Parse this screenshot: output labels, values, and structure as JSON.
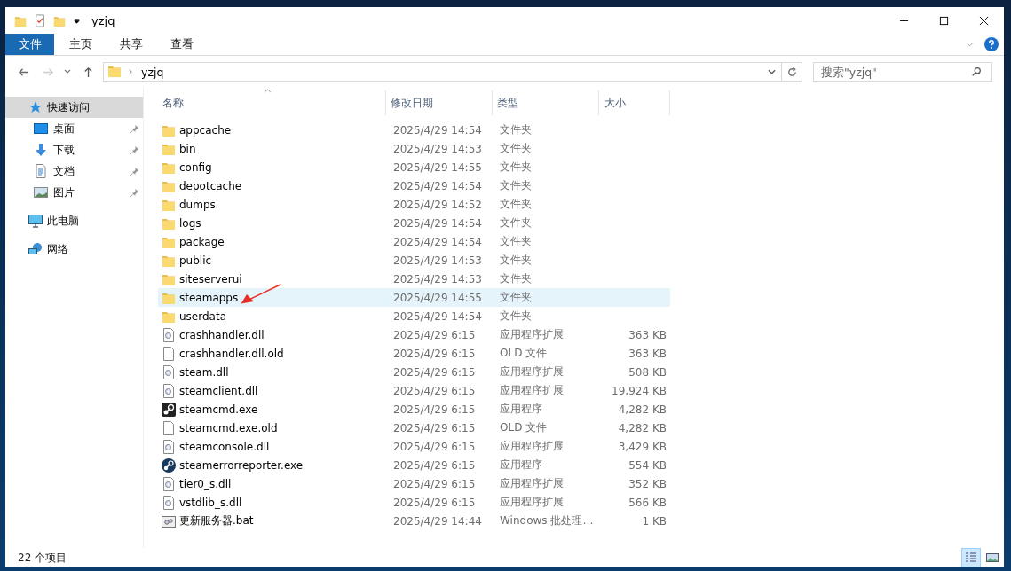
{
  "window": {
    "title": "yzjq"
  },
  "ribbon_tabs": [
    {
      "label": "文件",
      "selected": true
    },
    {
      "label": "主页",
      "selected": false
    },
    {
      "label": "共享",
      "selected": false
    },
    {
      "label": "查看",
      "selected": false
    }
  ],
  "address": {
    "path": "yzjq"
  },
  "search": {
    "placeholder": "搜索\"yzjq\""
  },
  "sidebar": {
    "items": [
      {
        "label": "快速访问",
        "kind": "star",
        "selected": true,
        "pinned": false,
        "children": [
          {
            "label": "桌面",
            "kind": "desktop",
            "selected": false,
            "pinned": true
          },
          {
            "label": "下载",
            "kind": "download",
            "selected": false,
            "pinned": true
          },
          {
            "label": "文档",
            "kind": "document",
            "selected": false,
            "pinned": true
          },
          {
            "label": "图片",
            "kind": "picture",
            "selected": false,
            "pinned": true
          }
        ]
      },
      {
        "label": "此电脑",
        "kind": "computer",
        "selected": false,
        "pinned": false
      },
      {
        "label": "网络",
        "kind": "network",
        "selected": false,
        "pinned": false
      }
    ]
  },
  "table": {
    "columns": [
      "名称",
      "修改日期",
      "类型",
      "大小"
    ],
    "rows": [
      {
        "name": "appcache",
        "date": "2025/4/29 14:54",
        "type": "文件夹",
        "kind": "folder",
        "selected": false
      },
      {
        "name": "bin",
        "date": "2025/4/29 14:53",
        "type": "文件夹",
        "kind": "folder",
        "selected": false
      },
      {
        "name": "config",
        "date": "2025/4/29 14:55",
        "type": "文件夹",
        "kind": "folder",
        "selected": false
      },
      {
        "name": "depotcache",
        "date": "2025/4/29 14:54",
        "type": "文件夹",
        "kind": "folder",
        "selected": false
      },
      {
        "name": "dumps",
        "date": "2025/4/29 14:52",
        "type": "文件夹",
        "kind": "folder",
        "selected": false
      },
      {
        "name": "logs",
        "date": "2025/4/29 14:54",
        "type": "文件夹",
        "kind": "folder",
        "selected": false
      },
      {
        "name": "package",
        "date": "2025/4/29 14:54",
        "type": "文件夹",
        "kind": "folder",
        "selected": false
      },
      {
        "name": "public",
        "date": "2025/4/29 14:53",
        "type": "文件夹",
        "kind": "folder",
        "selected": false
      },
      {
        "name": "siteserverui",
        "date": "2025/4/29 14:53",
        "type": "文件夹",
        "kind": "folder",
        "selected": false
      },
      {
        "name": "steamapps",
        "date": "2025/4/29 14:55",
        "type": "文件夹",
        "kind": "folder",
        "selected": true
      },
      {
        "name": "userdata",
        "date": "2025/4/29 14:54",
        "type": "文件夹",
        "kind": "folder",
        "selected": false
      },
      {
        "name": "crashhandler.dll",
        "date": "2025/4/29 6:15",
        "type": "应用程序扩展",
        "size": "363 KB",
        "kind": "dll",
        "selected": false
      },
      {
        "name": "crashhandler.dll.old",
        "date": "2025/4/29 6:15",
        "type": "OLD 文件",
        "size": "363 KB",
        "kind": "file",
        "selected": false
      },
      {
        "name": "steam.dll",
        "date": "2025/4/29 6:15",
        "type": "应用程序扩展",
        "size": "508 KB",
        "kind": "dll",
        "selected": false
      },
      {
        "name": "steamclient.dll",
        "date": "2025/4/29 6:15",
        "type": "应用程序扩展",
        "size": "19,924 KB",
        "kind": "dll",
        "selected": false
      },
      {
        "name": "steamcmd.exe",
        "date": "2025/4/29 6:15",
        "type": "应用程序",
        "size": "4,282 KB",
        "kind": "exe-square",
        "selected": false
      },
      {
        "name": "steamcmd.exe.old",
        "date": "2025/4/29 6:15",
        "type": "OLD 文件",
        "size": "4,282 KB",
        "kind": "file",
        "selected": false
      },
      {
        "name": "steamconsole.dll",
        "date": "2025/4/29 6:15",
        "type": "应用程序扩展",
        "size": "3,429 KB",
        "kind": "dll",
        "selected": false
      },
      {
        "name": "steamerrorreporter.exe",
        "date": "2025/4/29 6:15",
        "type": "应用程序",
        "size": "554 KB",
        "kind": "exe-round",
        "selected": false
      },
      {
        "name": "tier0_s.dll",
        "date": "2025/4/29 6:15",
        "type": "应用程序扩展",
        "size": "352 KB",
        "kind": "dll",
        "selected": false
      },
      {
        "name": "vstdlib_s.dll",
        "date": "2025/4/29 6:15",
        "type": "应用程序扩展",
        "size": "566 KB",
        "kind": "dll",
        "selected": false
      },
      {
        "name": "更新服务器.bat",
        "date": "2025/4/29 14:44",
        "type": "Windows 批处理…",
        "size": "1 KB",
        "kind": "bat",
        "selected": false
      }
    ]
  },
  "status_bar": {
    "count": "22 个项目"
  }
}
